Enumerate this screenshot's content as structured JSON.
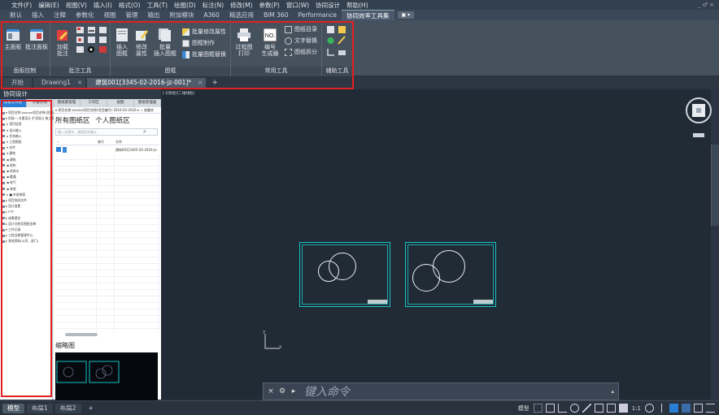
{
  "menu": [
    "文件(F)",
    "编辑(E)",
    "视图(V)",
    "插入(I)",
    "格式(O)",
    "工具(T)",
    "绘图(D)",
    "标注(N)",
    "修改(M)",
    "参数(P)",
    "窗口(W)",
    "协同设计",
    "帮助(H)"
  ],
  "window_controls": "_ ♂ ×",
  "ribbon_tabs": [
    "默认",
    "插入",
    "注释",
    "参数化",
    "视图",
    "管理",
    "输出",
    "附加模块",
    "A360",
    "精选应用",
    "BIM 360",
    "Performance",
    "协同效率工具集"
  ],
  "ribbon_active_tab": "协同效率工具集",
  "ribbon_extra": "▣ ▾",
  "groups": {
    "panel_control": {
      "label": "面板控制",
      "main_panel": "主面板",
      "annot_panel": "批注面板"
    },
    "annot_tools": {
      "label": "批注工具",
      "add_annot_1": "加载",
      "add_annot_2": "批注"
    },
    "frame": {
      "label": "图框",
      "insert_1": "插入",
      "insert_2": "图框",
      "modify_1": "修改",
      "modify_2": "属性",
      "batch_1": "批量",
      "batch_2": "插入图框",
      "s1": "批量修改属性",
      "s2": "图框制作",
      "s3": "批量图框替换"
    },
    "common": {
      "label": "常用工具",
      "print_1": "过程图",
      "print_2": "打印",
      "num_1": "编号",
      "num_2": "生成器",
      "s1": "图纸目录",
      "s2": "文字替换",
      "s3": "图纸拆分"
    },
    "aux": {
      "label": "辅助工具"
    }
  },
  "file_tabs": [
    {
      "label": "开始",
      "active": false
    },
    {
      "label": "Drawing1",
      "active": false
    },
    {
      "label": "建筑001[3345-02-2016-jz-001]*",
      "active": true
    }
  ],
  "palette": {
    "title": "协同设计",
    "tabs": [
      "项目文件夹",
      "外部参照",
      "图纸集管理",
      "工作区",
      "视图",
      "图纸管理器"
    ],
    "tree_rows": [
      "▾ 项目名称-xxxxxx项目名称(项目编号)",
      "▾ 阶段一-方案设计 扩初设计 施工图设计",
      "  ▸ 项目信息",
      "  ▾ 设计输入",
      "    ▸ 任务输入",
      "  ▾ 工程图纸",
      "    ▾ 文件",
      "      ▾ 建筑",
      "        ▪ 建筑",
      "        ▪ 结构",
      "        ▪ 给排水",
      "        ▪ 暖通",
      "        ▪ 电气",
      "        ▪ 其他",
      "  ▸ ■ 外部参照",
      "▸ 项目协同文件",
      "▸ 设计变更",
      "▸ FTP",
      "▸ 成果提交",
      "▸ 设计交底及图纸会审",
      "▾ 工作记录",
      "▸ 工程洽商管理中心",
      "▸ 其他资料(公司、部门)"
    ],
    "right_top": "▾ 项目名称-xxxxxx项目名称(项目编号) 2016-02-2016 ▾  ☆ 收藏夹",
    "heading_a": "所有图纸区",
    "heading_b": "个人图纸区",
    "search_placeholder": "输入关键字，请按回车确认",
    "col_check": "✓",
    "col_num": "编号",
    "col_name": "名称",
    "row_name": "建筑001[3345-02-2016-jz-001]",
    "thumb_title": "缩略图"
  },
  "viewport": {
    "label": "[-][俯视][二维线框]"
  },
  "command": {
    "placeholder": "键入命令"
  },
  "layouts": [
    "模型",
    "布局1",
    "布局2"
  ],
  "status_model": "模型",
  "status_scale": "1:1",
  "colors": {
    "frame_red": "#e02020",
    "cad_cyan": "#14c6c6",
    "viewport_bg": "#212b36",
    "accent_blue": "#2a7fd4"
  }
}
